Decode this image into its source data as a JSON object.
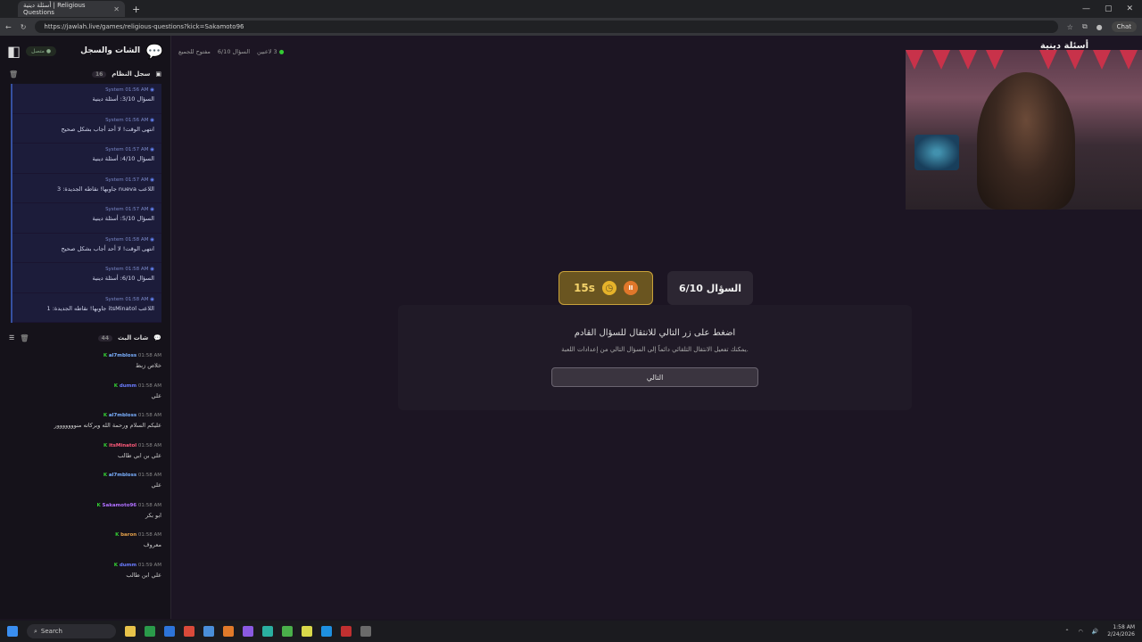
{
  "browser": {
    "tab_title": "أسئلة دينية | Religious Questions",
    "url": "https://jawlah.live/games/religious-questions?kick=Sakamoto96",
    "chat_label": "Chat"
  },
  "sidebar": {
    "title": "الشات والسجل",
    "live_badge": "متصل",
    "system_log": {
      "title": "سجل النظام",
      "count": "16",
      "messages": [
        {
          "time": "01:56 AM",
          "sender": "System",
          "text": "السؤال 3/10: أسئلة دينية"
        },
        {
          "time": "01:56 AM",
          "sender": "System",
          "text": "انتهى الوقت! لا أحد أجاب بشكل صحيح"
        },
        {
          "time": "01:57 AM",
          "sender": "System",
          "text": "السؤال 4/10: أسئلة دينية"
        },
        {
          "time": "01:57 AM",
          "sender": "System",
          "text": "اللاعب nueva جاوبها! نقاطه الجديدة: 3"
        },
        {
          "time": "01:57 AM",
          "sender": "System",
          "text": "السؤال 5/10: أسئلة دينية"
        },
        {
          "time": "01:58 AM",
          "sender": "System",
          "text": "انتهى الوقت! لا أحد أجاب بشكل صحيح"
        },
        {
          "time": "01:58 AM",
          "sender": "System",
          "text": "السؤال 6/10: أسئلة دينية"
        },
        {
          "time": "01:58 AM",
          "sender": "System",
          "text": "اللاعب itsMinatol جاوبها! نقاطه الجديدة: 1"
        }
      ]
    },
    "live_chat": {
      "title": "شات البث",
      "count": "44",
      "messages": [
        {
          "user": "al7mbloss",
          "time": "01:58 AM",
          "color": "#7ab0ff",
          "text": "خلاص زبط"
        },
        {
          "user": "dumm",
          "time": "01:58 AM",
          "color": "#6a7cff",
          "text": "علي"
        },
        {
          "user": "al7mbloss",
          "time": "01:58 AM",
          "color": "#7ab0ff",
          "text": "عليكم السلام ورحمة الله وبركاته منووووووور"
        },
        {
          "user": "itsMinatol",
          "time": "01:58 AM",
          "color": "#ff5a7a",
          "text": "علي بن ابي طالب"
        },
        {
          "user": "al7mbloss",
          "time": "01:58 AM",
          "color": "#7ab0ff",
          "text": "علي"
        },
        {
          "user": "Sakamoto96",
          "time": "01:58 AM",
          "color": "#b070ff",
          "text": "ابو بكر"
        },
        {
          "user": "baron",
          "time": "01:58 AM",
          "color": "#e6a24a",
          "text": "معروف"
        },
        {
          "user": "dumm",
          "time": "01:59 AM",
          "color": "#6a7cff",
          "text": "علي ابن طالب"
        }
      ]
    }
  },
  "main": {
    "app_title": "أسئلة دينية",
    "info": {
      "players": "3 لاعبين",
      "question": "السؤال 6/10",
      "mode": "مفتوح للجميع"
    },
    "timer": "15s",
    "question_counter": "السؤال 6/10",
    "instruction": "اضغط على زر التالي للانتقال للسؤال القادم",
    "subtext": "يمكنك تفعيل الانتقال التلقائي دائماً إلى السؤال التالي من إعدادات اللعبة.",
    "next_label": "التالي"
  },
  "taskbar": {
    "search_label": "Search",
    "time": "1:58 AM",
    "date": "2/24/2026"
  }
}
